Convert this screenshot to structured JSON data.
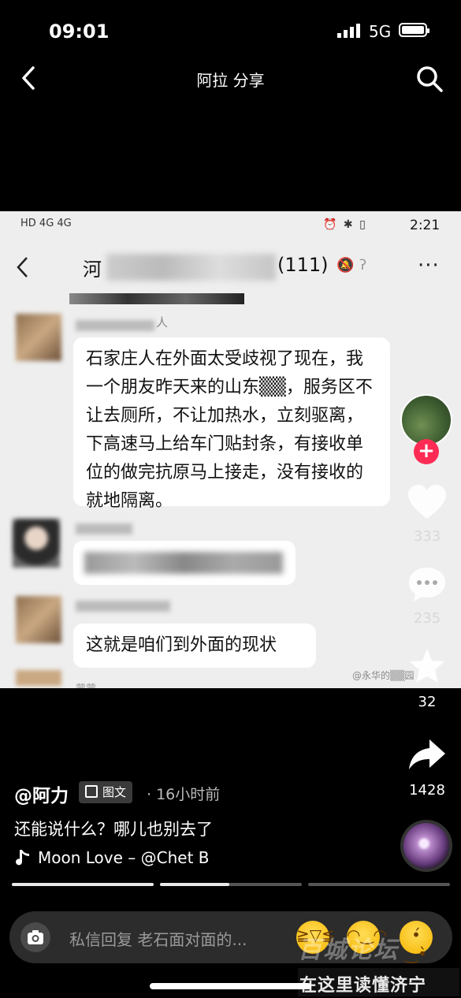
{
  "status_bar": {
    "time": "09:01",
    "network": "5G"
  },
  "header": {
    "title": "阿拉 分享"
  },
  "screenshot": {
    "status_time": "2:21",
    "status_left": "HD 4G 4G",
    "status_icons": "⏰ ✱ ▯",
    "chat_title_prefix": "河",
    "chat_title_suffix": "(111)",
    "name_suffix": "人",
    "message1": "石家庄人在外面太受歧视了现在，我一个朋友昨天来的山东▒▒，服务区不让去厕所，不让加热水，立刻驱离，下高速马上给车门贴封条，有接收单位的做完抗原马上接走，没有接收的就地隔离。",
    "message3": "这就是咱们到外面的现状",
    "watermark": "@永华的▒▒园",
    "bottom_name": "蒙蒙"
  },
  "rail": {
    "likes": "333",
    "comments": "235",
    "favorites": "32",
    "shares": "1428"
  },
  "post": {
    "author": "@阿力",
    "type_tag": "图文",
    "time_ago": "· 16小时前",
    "description": "还能说什么？哪儿也别去了",
    "music": "Moon Love – @Chet B"
  },
  "reply": {
    "placeholder": "私信回复 老石面对面的..."
  },
  "watermark_logo": {
    "text": "百城论坛",
    "subtitle": "在这里读懂济宁"
  }
}
